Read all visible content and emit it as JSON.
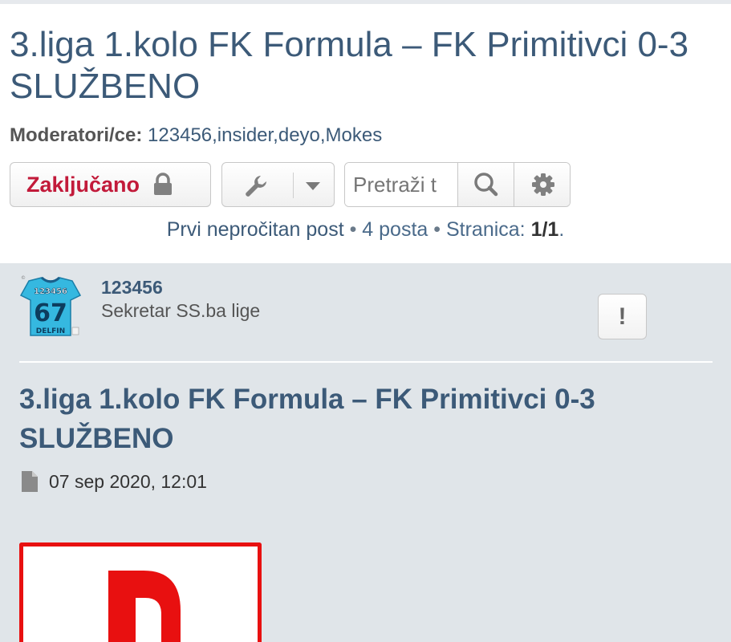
{
  "topic": {
    "title": "3.liga 1.kolo FK Formula – FK Primitivci 0-3 SLUŽBENO"
  },
  "moderators": {
    "label": "Moderatori/ce:",
    "list": "123456,insider,deyo,Mokes"
  },
  "actions": {
    "locked_label": "Zaključano",
    "lock_icon": "lock-icon",
    "tools_icon": "wrench-icon",
    "dropdown_icon": "caret-down-icon",
    "search_placeholder": "Pretraži t",
    "search_icon": "search-icon",
    "settings_icon": "gear-icon"
  },
  "pagination": {
    "first_unread": "Prvi nepročitan post",
    "sep1": " • ",
    "post_count": "4 posta",
    "sep2": " • ",
    "page_label": "Stranica: ",
    "page_value": "1/1",
    "page_end": "."
  },
  "post": {
    "author": "123456",
    "rank": "Sekretar SS.ba lige",
    "avatar": {
      "shirt_name": "123456",
      "shirt_number": "67",
      "team": "DELFIN"
    },
    "report_label": "!",
    "title": "3.liga 1.kolo FK Formula – FK Primitivci 0-3 SLUŽBENO",
    "date": "07 sep 2020, 12:01",
    "date_icon": "document-icon"
  },
  "colors": {
    "link": "#3c5a78",
    "locked": "#c21a3a",
    "post_bg": "#e0e5e9",
    "image_red": "#e81010",
    "avatar_shirt": "#35b8e0"
  }
}
